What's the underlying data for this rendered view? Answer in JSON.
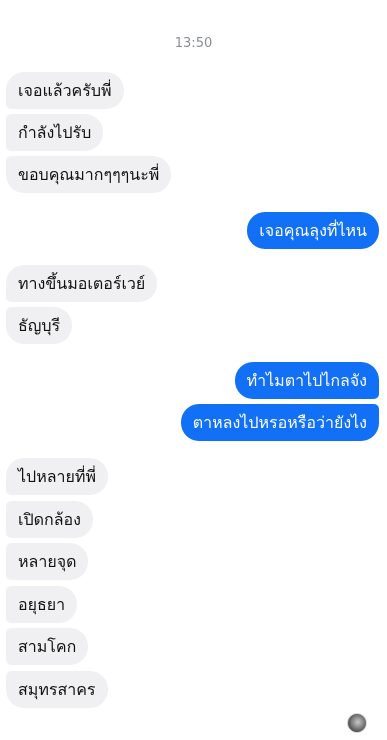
{
  "chat": {
    "timestamp": "13:50",
    "messages": [
      {
        "text": "เจอแล้วครับพี่",
        "dir": "in"
      },
      {
        "text": "กำลังไปรับ",
        "dir": "in"
      },
      {
        "text": "ขอบคุณมากๆๆๆนะพี่",
        "dir": "in"
      },
      {
        "text": "เจอคุณลุงที่ไหน",
        "dir": "out"
      },
      {
        "text": "ทางขึ้นมอเตอร์เวย์",
        "dir": "in"
      },
      {
        "text": "ธัญบุรี",
        "dir": "in"
      },
      {
        "text": "ทำไมตาไปไกลจัง",
        "dir": "out"
      },
      {
        "text": "ตาหลงไปหรอหรือว่ายังไง",
        "dir": "out"
      },
      {
        "text": "ไปหลายที่พี่",
        "dir": "in"
      },
      {
        "text": "เปิดกล้อง",
        "dir": "in"
      },
      {
        "text": "หลายจุด",
        "dir": "in"
      },
      {
        "text": "อยุธยา",
        "dir": "in"
      },
      {
        "text": "สามโคก",
        "dir": "in"
      },
      {
        "text": "สมุทรสาคร",
        "dir": "in"
      }
    ]
  },
  "colors": {
    "outgoing_bubble": "#1170f5",
    "incoming_bubble": "#f0f0f3"
  },
  "read_receipt": {
    "icon": "seen-avatar-icon"
  }
}
